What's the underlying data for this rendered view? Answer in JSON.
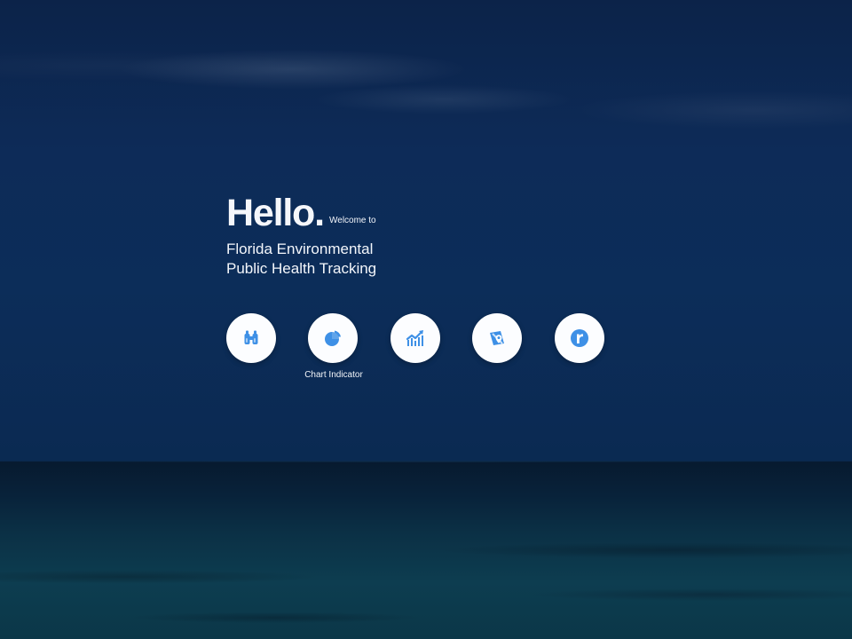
{
  "hero": {
    "heading": "Hello.",
    "welcome": "Welcome to",
    "title_lines": [
      "Florida Environmental",
      "Public Health Tracking"
    ]
  },
  "actions": [
    {
      "icon": "binoculars-icon"
    },
    {
      "icon": "pie-chart-icon",
      "label": "Chart Indicator"
    },
    {
      "icon": "trend-chart-icon"
    },
    {
      "icon": "map-pin-icon"
    },
    {
      "icon": "letter-r-icon"
    }
  ],
  "colors": {
    "accent": "#3e90e6",
    "button_bg": "#fcfdff",
    "text": "#f3f6fb",
    "sky": "#0c2d59",
    "sea": "#0d3d50"
  }
}
